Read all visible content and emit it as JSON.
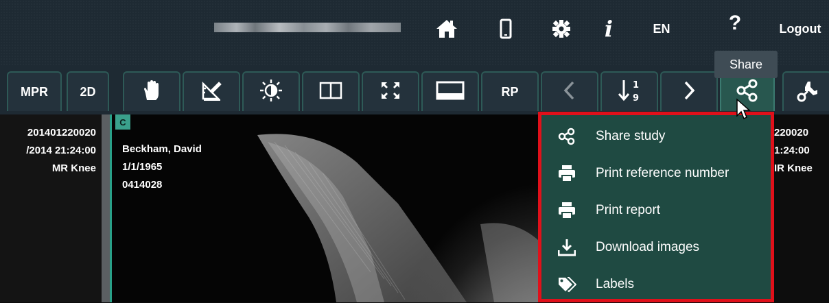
{
  "header": {
    "language": "EN",
    "help_label": "?",
    "logout_label": "Logout",
    "icons": [
      "home-icon",
      "mobile-icon",
      "gear-icon",
      "info-icon"
    ]
  },
  "tooltip": {
    "text": "Share"
  },
  "toolbar": {
    "mpr_label": "MPR",
    "twod_label": "2D",
    "rp_label": "RP",
    "icons": [
      "hand-pan-icon",
      "measure-icon",
      "contrast-icon",
      "layout-split-icon",
      "fullscreen-icon",
      "screen-icon",
      "prev-icon",
      "sort-icon",
      "next-icon",
      "share-icon",
      "tools-icon"
    ],
    "active": "share"
  },
  "viewer": {
    "left_pane": {
      "line1": "201401220020",
      "line2": "/2014 21:24:00",
      "line3": "MR Knee"
    },
    "main_pane": {
      "cell_label": "C",
      "patient_name": "Beckham, David",
      "birth_date": "1/1/1965",
      "patient_id": "0414028"
    },
    "right_pane": {
      "line1": "220020",
      "line2": "1:24:00",
      "line3": "IR Knee"
    }
  },
  "share_menu": {
    "items": [
      {
        "label": "Share study",
        "icon": "share-icon"
      },
      {
        "label": "Print reference number",
        "icon": "printer-icon"
      },
      {
        "label": "Print report",
        "icon": "printer-icon"
      },
      {
        "label": "Download images",
        "icon": "download-icon"
      },
      {
        "label": "Labels",
        "icon": "tag-icon"
      }
    ]
  },
  "colors": {
    "header_bg": "#1e2a33",
    "toolbar_active": "#28574f",
    "menu_bg": "#1f4a42",
    "menu_border": "#e0101a",
    "accent": "#3aa08b"
  }
}
